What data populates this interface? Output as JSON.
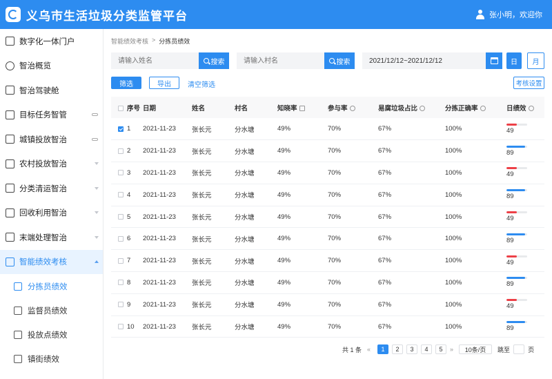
{
  "header": {
    "title": "义乌市生活垃圾分类监管平台",
    "user_greeting": "张小明，欢迎你"
  },
  "sidebar": {
    "items": [
      {
        "label": "数字化一体门户",
        "icon": "grid-icon",
        "arrow": "none"
      },
      {
        "label": "智治概览",
        "icon": "dashboard-icon",
        "arrow": "none"
      },
      {
        "label": "智治驾驶舱",
        "icon": "monitor-chart-icon",
        "arrow": "none"
      },
      {
        "label": "目标任务智管",
        "icon": "list-icon",
        "arrow": "link"
      },
      {
        "label": "城镇投放智治",
        "icon": "screen-icon",
        "arrow": "link"
      },
      {
        "label": "农村投放智治",
        "icon": "house-icon",
        "arrow": "down"
      },
      {
        "label": "分类清运智治",
        "icon": "truck-icon",
        "arrow": "down"
      },
      {
        "label": "回收利用智治",
        "icon": "recycle-icon",
        "arrow": "down"
      },
      {
        "label": "末端处理智治",
        "icon": "factory-icon",
        "arrow": "down"
      },
      {
        "label": "智能绩效考核",
        "icon": "layers-icon",
        "arrow": "up"
      }
    ],
    "sub_items": [
      {
        "label": "分拣员绩效",
        "icon": "sorter-icon",
        "active": true
      },
      {
        "label": "监督员绩效",
        "icon": "inspector-icon",
        "active": false
      },
      {
        "label": "投放点绩效",
        "icon": "dropoff-icon",
        "active": false
      },
      {
        "label": "镇街绩效",
        "icon": "town-chart-icon",
        "active": false
      }
    ]
  },
  "breadcrumb": {
    "parent": "智能绩效考核",
    "separator": ">",
    "current": "分拣员绩效"
  },
  "search": {
    "name_placeholder": "请输入姓名",
    "village_placeholder": "请输入村名",
    "button_label": "搜索",
    "date_range": "2021/12/12~2021/12/12",
    "day_label": "日",
    "month_label": "月"
  },
  "actions": {
    "filter": "筛选",
    "export": "导出",
    "clear": "清空筛选",
    "settings": "考核设置"
  },
  "table": {
    "headers": [
      "序号",
      "日期",
      "姓名",
      "村名",
      "知晓率",
      "参与率",
      "易腐垃圾占比",
      "分拣正确率",
      "日绩效"
    ],
    "rows": [
      {
        "no": "1",
        "date": "2021-11-23",
        "name": "张长元",
        "village": "分水塘",
        "awareness": "49%",
        "participation": "70%",
        "perishable": "67%",
        "accuracy": "100%",
        "score": "49",
        "score_fraction": 0.49,
        "checked": true,
        "color": "#ed4047"
      },
      {
        "no": "2",
        "date": "2021-11-23",
        "name": "张长元",
        "village": "分水塘",
        "awareness": "49%",
        "participation": "70%",
        "perishable": "67%",
        "accuracy": "100%",
        "score": "89",
        "score_fraction": 0.89,
        "checked": false,
        "color": "#2d8cf0"
      },
      {
        "no": "3",
        "date": "2021-11-23",
        "name": "张长元",
        "village": "分水塘",
        "awareness": "49%",
        "participation": "70%",
        "perishable": "67%",
        "accuracy": "100%",
        "score": "49",
        "score_fraction": 0.49,
        "checked": false,
        "color": "#ed4047"
      },
      {
        "no": "4",
        "date": "2021-11-23",
        "name": "张长元",
        "village": "分水塘",
        "awareness": "49%",
        "participation": "70%",
        "perishable": "67%",
        "accuracy": "100%",
        "score": "89",
        "score_fraction": 0.89,
        "checked": false,
        "color": "#2d8cf0"
      },
      {
        "no": "5",
        "date": "2021-11-23",
        "name": "张长元",
        "village": "分水塘",
        "awareness": "49%",
        "participation": "70%",
        "perishable": "67%",
        "accuracy": "100%",
        "score": "49",
        "score_fraction": 0.49,
        "checked": false,
        "color": "#ed4047"
      },
      {
        "no": "6",
        "date": "2021-11-23",
        "name": "张长元",
        "village": "分水塘",
        "awareness": "49%",
        "participation": "70%",
        "perishable": "67%",
        "accuracy": "100%",
        "score": "89",
        "score_fraction": 0.89,
        "checked": false,
        "color": "#2d8cf0"
      },
      {
        "no": "7",
        "date": "2021-11-23",
        "name": "张长元",
        "village": "分水塘",
        "awareness": "49%",
        "participation": "70%",
        "perishable": "67%",
        "accuracy": "100%",
        "score": "49",
        "score_fraction": 0.49,
        "checked": false,
        "color": "#ed4047"
      },
      {
        "no": "8",
        "date": "2021-11-23",
        "name": "张长元",
        "village": "分水塘",
        "awareness": "49%",
        "participation": "70%",
        "perishable": "67%",
        "accuracy": "100%",
        "score": "89",
        "score_fraction": 0.89,
        "checked": false,
        "color": "#2d8cf0"
      },
      {
        "no": "9",
        "date": "2021-11-23",
        "name": "张长元",
        "village": "分水塘",
        "awareness": "49%",
        "participation": "70%",
        "perishable": "67%",
        "accuracy": "100%",
        "score": "49",
        "score_fraction": 0.49,
        "checked": false,
        "color": "#ed4047"
      },
      {
        "no": "10",
        "date": "2021-11-23",
        "name": "张长元",
        "village": "分水塘",
        "awareness": "49%",
        "participation": "70%",
        "perishable": "67%",
        "accuracy": "100%",
        "score": "89",
        "score_fraction": 0.89,
        "checked": false,
        "color": "#2d8cf0"
      }
    ]
  },
  "pagination": {
    "total": "共 1 条",
    "prev": "«",
    "pages": [
      "1",
      "2",
      "3",
      "4",
      "5"
    ],
    "current": "1",
    "next": "»",
    "page_size": "10条/页",
    "jump_label": "跳至",
    "page_unit": "页"
  },
  "colors": {
    "primary": "#2d8cf0",
    "low_score": "#ed4047",
    "high_score": "#2d8cf0"
  }
}
